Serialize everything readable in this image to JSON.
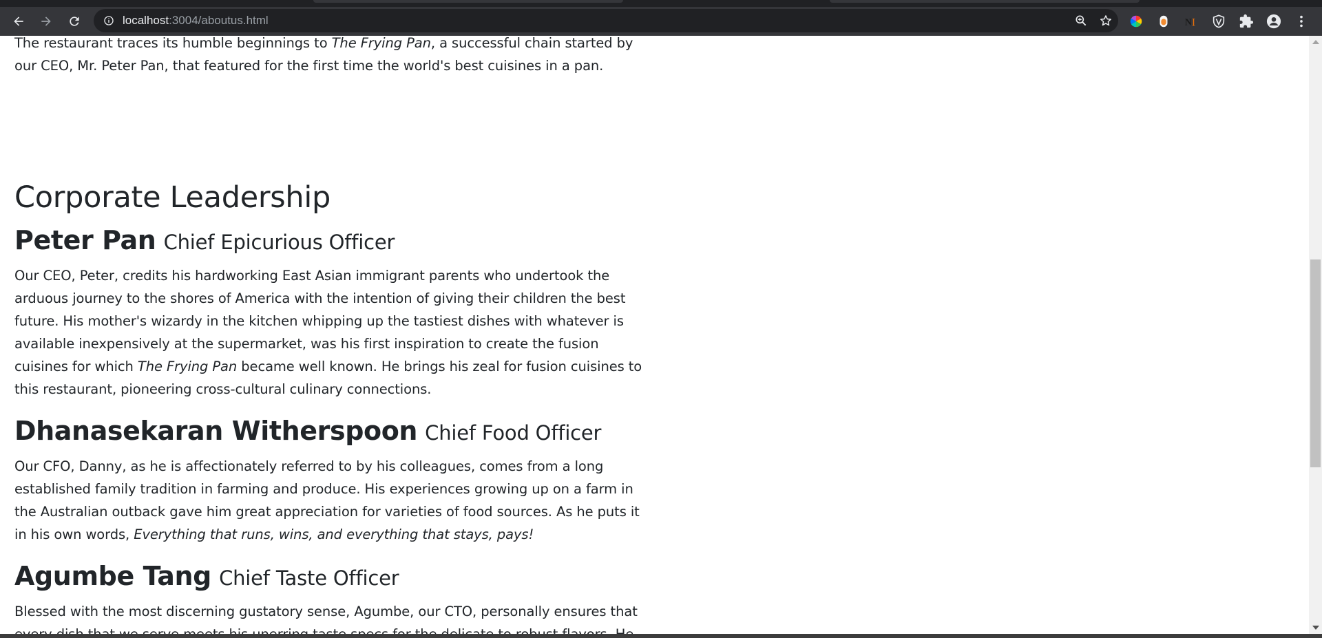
{
  "browser": {
    "url_host": "localhost",
    "url_rest": ":3004/aboutus.html"
  },
  "page": {
    "intro": {
      "before": "The restaurant traces its humble beginnings to ",
      "italic": "The Frying Pan",
      "after": ", a successful chain started by our CEO, Mr. Peter Pan, that featured for the first time the world's best cuisines in a pan."
    },
    "section_heading": "Corporate Leadership",
    "leaders": [
      {
        "name": "Peter Pan",
        "title": "Chief Epicurious Officer",
        "bio_before": "Our CEO, Peter, credits his hardworking East Asian immigrant parents who undertook the arduous journey to the shores of America with the intention of giving their children the best future. His mother's wizardy in the kitchen whipping up the tastiest dishes with whatever is available inexpensively at the supermarket, was his first inspiration to create the fusion cuisines for which ",
        "bio_italic": "The Frying Pan",
        "bio_after": " became well known. He brings his zeal for fusion cuisines to this restaurant, pioneering cross-cultural culinary connections."
      },
      {
        "name": "Dhanasekaran Witherspoon",
        "title": "Chief Food Officer",
        "bio_before": "Our CFO, Danny, as he is affectionately referred to by his colleagues, comes from a long established family tradition in farming and produce. His experiences growing up on a farm in the Australian outback gave him great appreciation for varieties of food sources. As he puts it in his own words, ",
        "bio_italic": "Everything that runs, wins, and everything that stays, pays!",
        "bio_after": ""
      },
      {
        "name": "Agumbe Tang",
        "title": "Chief Taste Officer",
        "bio_before": "Blessed with the most discerning gustatory sense, Agumbe, our CTO, personally ensures that every dish that we serve meets his unerring taste specs for the delicate to robust flavors. He brings a wealth of culinary and food sense to the table.",
        "bio_italic": "",
        "bio_after": ""
      }
    ]
  },
  "icons": {
    "back": "back-arrow-icon",
    "forward": "forward-arrow-icon",
    "reload": "reload-icon",
    "info": "site-info-icon",
    "zoom": "zoom-icon",
    "bookmark": "star-icon",
    "extensions": [
      "color-wheel-extension-icon",
      "orange-pill-extension-icon",
      "ni-extension-icon",
      "shield-extension-icon",
      "puzzle-icon",
      "profile-icon",
      "kebab-menu-icon"
    ]
  },
  "colors": {
    "chrome_dark": "#202124",
    "toolbar": "#35363a",
    "text": "#212529"
  },
  "scroll_position": 0.5
}
